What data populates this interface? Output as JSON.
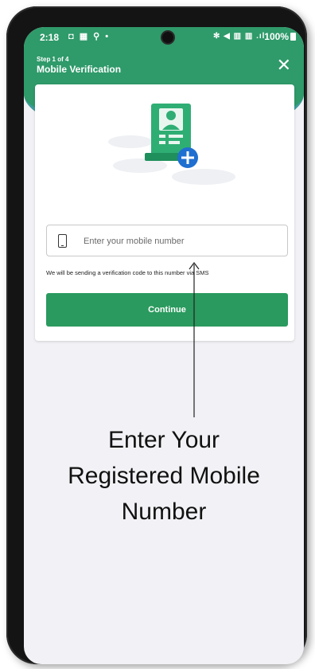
{
  "status_bar": {
    "time": "2:18",
    "left_icons": "◘ ▦ ⚲ •",
    "right_icons": "✻ ◀ ▥ ▥ .ıl",
    "battery": "100%"
  },
  "header": {
    "step": "Step 1 of 4",
    "title": "Mobile Verification",
    "close_label": "✕"
  },
  "form": {
    "mobile_placeholder": "Enter your mobile number",
    "mobile_value": "",
    "hint": "We will be sending a verification code to this number via SMS",
    "continue_label": "Continue"
  },
  "annotation": {
    "line1": "Enter Your",
    "line2": "Registered Mobile",
    "line3": "Number"
  },
  "colors": {
    "brand_green": "#2a9a5e",
    "header_green": "#2f9a6a",
    "header_teal": "#1e8c8c",
    "plus_badge": "#1f6fd1"
  },
  "icons": [
    "camera-icon",
    "close-icon",
    "id-card-illustration",
    "add-badge-icon",
    "mobile-phone-icon",
    "arrow-icon"
  ]
}
